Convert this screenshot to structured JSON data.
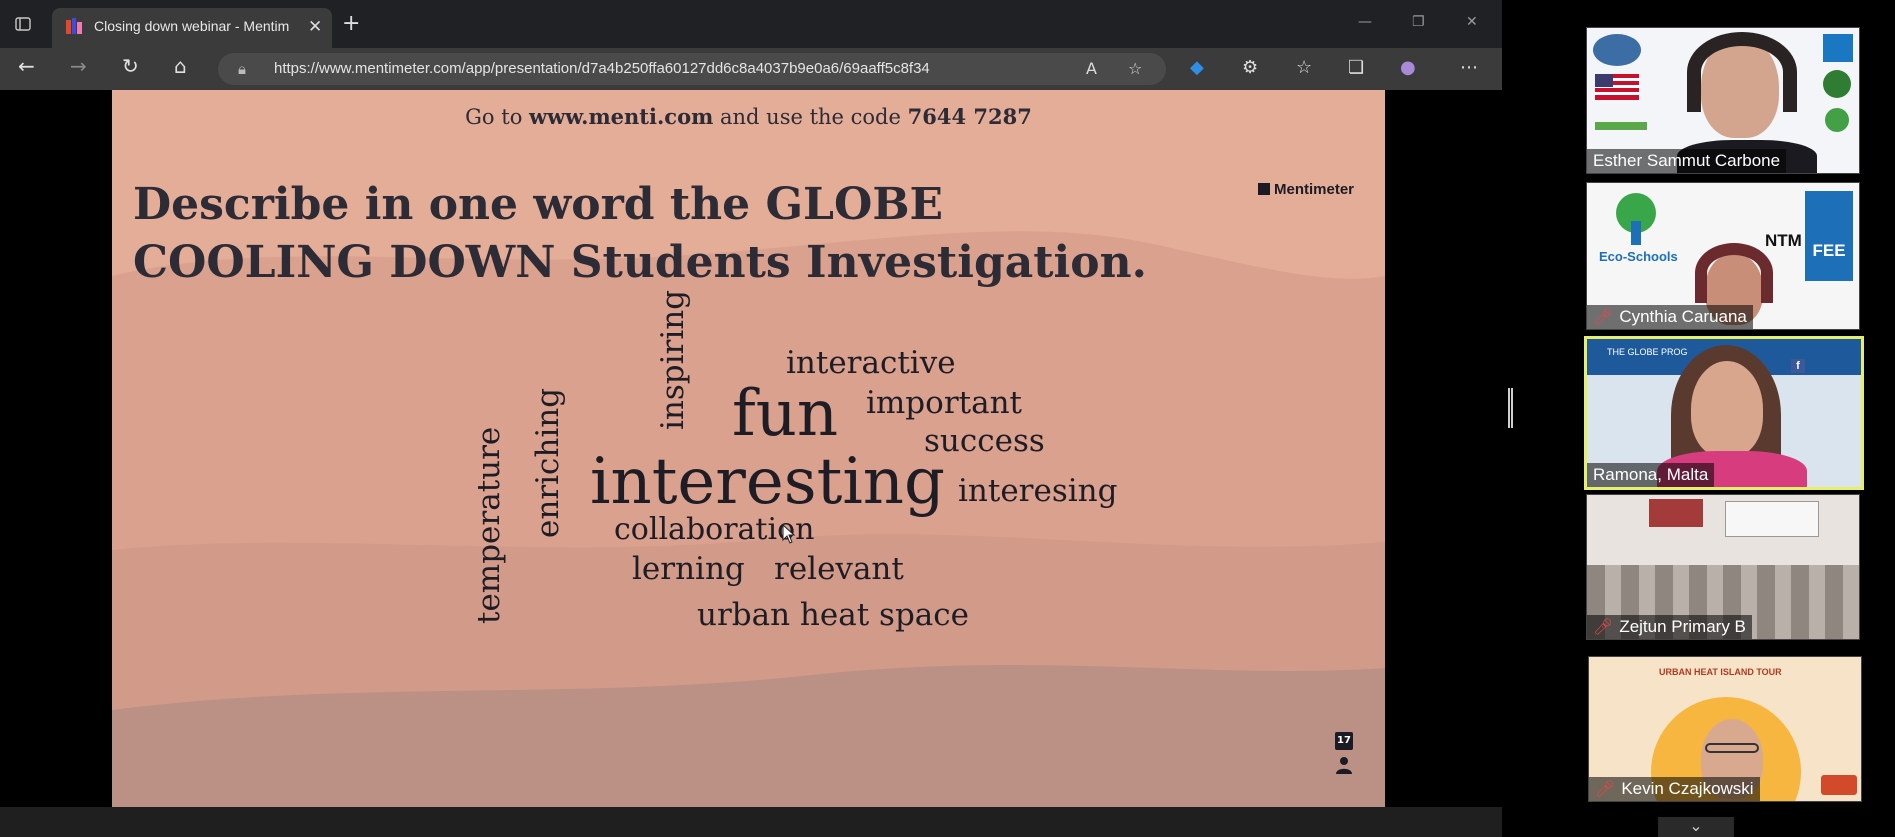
{
  "browser": {
    "tab_title": "Closing down webinar - Mentim",
    "url": "https://www.mentimeter.com/app/presentation/d7a4b250ffa60127dd6c8a4037b9e0a6/69aaff5c8f34"
  },
  "slide": {
    "join_prefix": "Go to",
    "join_site": "www.menti.com",
    "join_mid": "and use the code",
    "join_code": "7644 7287",
    "question": "Describe in one word the GLOBE COOLING DOWN Students Investigation.",
    "logo": "Mentimeter",
    "response_count": "17",
    "words": {
      "inspiring": "inspiring",
      "interactive": "interactive",
      "fun": "fun",
      "important": "important",
      "enriching": "enriching",
      "success": "success",
      "interesting": "interesting",
      "interesing": "interesing",
      "temperature": "temperature",
      "collaboration": "collaboration",
      "lerning": "lerning",
      "relevant": "relevant",
      "urban_heat_space": "urban heat space"
    }
  },
  "participants": [
    {
      "name": "Esther Sammut Carbone",
      "muted": false
    },
    {
      "name": "Cynthia Caruana",
      "muted": true
    },
    {
      "name": "Ramona, Malta",
      "muted": false,
      "speaking": true
    },
    {
      "name": "Zejtun Primary B",
      "muted": true
    },
    {
      "name": "Kevin Czajkowski",
      "muted": true
    }
  ],
  "tile_texts": {
    "eco_schools": "Eco-Schools",
    "fee": "FEE",
    "ntm": "NTM",
    "urban_heat_tour": "URBAN HEAT ISLAND TOUR",
    "globe_banner": "THE GLOBE PROG"
  },
  "colors": {
    "slide_bg": "#e4ad98",
    "slide_text": "#2c2b36",
    "speaking_border": "#e7ef6a"
  }
}
